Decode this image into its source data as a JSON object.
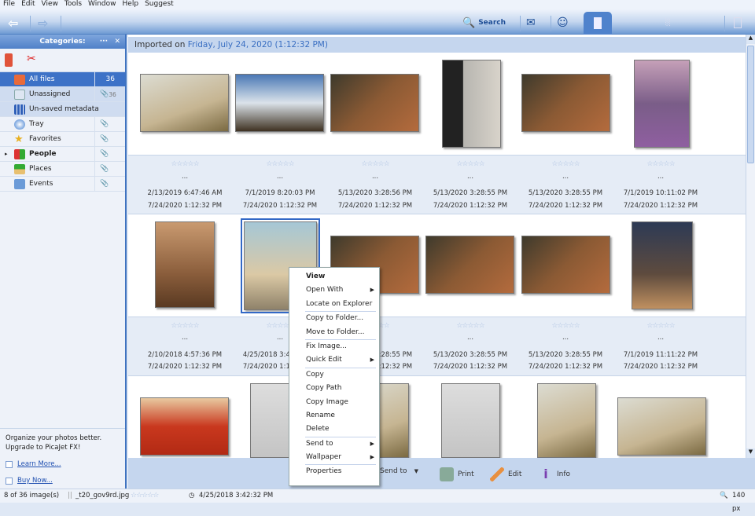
{
  "menu": [
    "File",
    "Edit",
    "View",
    "Tools",
    "Window",
    "Help",
    "Suggest"
  ],
  "toolbar": {
    "search": "Search"
  },
  "sidebar": {
    "title": "Categories:",
    "more": "···",
    "close": "✕",
    "items": [
      {
        "label": "All files",
        "count": "36"
      },
      {
        "label": "Unassigned",
        "count": "36"
      },
      {
        "label": "Un-saved metadata",
        "count": ""
      },
      {
        "label": "Tray"
      },
      {
        "label": "Favorites"
      },
      {
        "label": "People"
      },
      {
        "label": "Places"
      },
      {
        "label": "Events"
      }
    ],
    "promo": "Organize your photos better. Upgrade to PicaJet FX!",
    "learn": "Learn More...",
    "buy": "Buy Now..."
  },
  "header": {
    "prefix": "Imported on",
    "date": "Friday, July 24, 2020 (1:12:32 PM)"
  },
  "stars": "☆☆☆☆☆",
  "ellipsis": "...",
  "rows": [
    {
      "taken": [
        "2/13/2019 6:47:46 AM",
        "7/1/2019 8:20:03 PM",
        "5/13/2020 3:28:56 PM",
        "5/13/2020 3:28:55 PM",
        "5/13/2020 3:28:55 PM",
        "7/1/2019 10:11:02 PM"
      ],
      "imported": "7/24/2020 1:12:32 PM"
    },
    {
      "taken": [
        "2/10/2018 4:57:36 PM",
        "4/25/2018 3:42:32 PM",
        "5/13/2020 3:28:55 PM",
        "5/13/2020 3:28:55 PM",
        "5/13/2020 3:28:55 PM",
        "7/1/2019 11:11:22 PM"
      ],
      "imported": "7/24/2020 1:12:32 PM"
    }
  ],
  "context_menu": [
    "View",
    "Open With",
    "Locate on Explorer",
    "Copy to Folder...",
    "Move to Folder...",
    "Fix Image...",
    "Quick Edit",
    "Copy",
    "Copy Path",
    "Copy Image",
    "Rename",
    "Delete",
    "Send to",
    "Wallpaper",
    "Properties"
  ],
  "bottom": {
    "send": "Send to",
    "print": "Print",
    "edit": "Edit",
    "info": "Info"
  },
  "status": {
    "count": "8 of 36 image(s)",
    "file": "_t20_gov9rd.jpg",
    "date": "4/25/2018 3:42:32 PM",
    "zoom": "140 px"
  }
}
